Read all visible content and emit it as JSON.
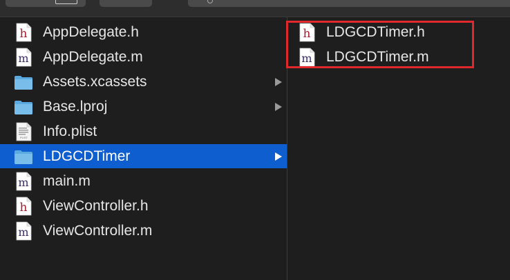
{
  "navigator": {
    "column1": [
      {
        "label": "AppDelegate.h",
        "type": "h",
        "has_children": false,
        "selected": false
      },
      {
        "label": "AppDelegate.m",
        "type": "m",
        "has_children": false,
        "selected": false
      },
      {
        "label": "Assets.xcassets",
        "type": "folder",
        "has_children": true,
        "selected": false
      },
      {
        "label": "Base.lproj",
        "type": "folder",
        "has_children": true,
        "selected": false
      },
      {
        "label": "Info.plist",
        "type": "plist",
        "has_children": false,
        "selected": false
      },
      {
        "label": "LDGCDTimer",
        "type": "folder",
        "has_children": true,
        "selected": true
      },
      {
        "label": "main.m",
        "type": "m",
        "has_children": false,
        "selected": false
      },
      {
        "label": "ViewController.h",
        "type": "h",
        "has_children": false,
        "selected": false
      },
      {
        "label": "ViewController.m",
        "type": "m",
        "has_children": false,
        "selected": false
      }
    ],
    "column2": [
      {
        "label": "LDGCDTimer.h",
        "type": "h"
      },
      {
        "label": "LDGCDTimer.m",
        "type": "m"
      }
    ],
    "icon_letters": {
      "h": "h",
      "m": "m",
      "plist": "PLIST"
    }
  },
  "colors": {
    "background": "#1e1e1e",
    "selection": "#0f5ecf",
    "highlight_box": "#e0282d",
    "h_letter": "#a61d2d",
    "m_letter": "#3b2a6e",
    "folder": "#5aa9e0"
  }
}
